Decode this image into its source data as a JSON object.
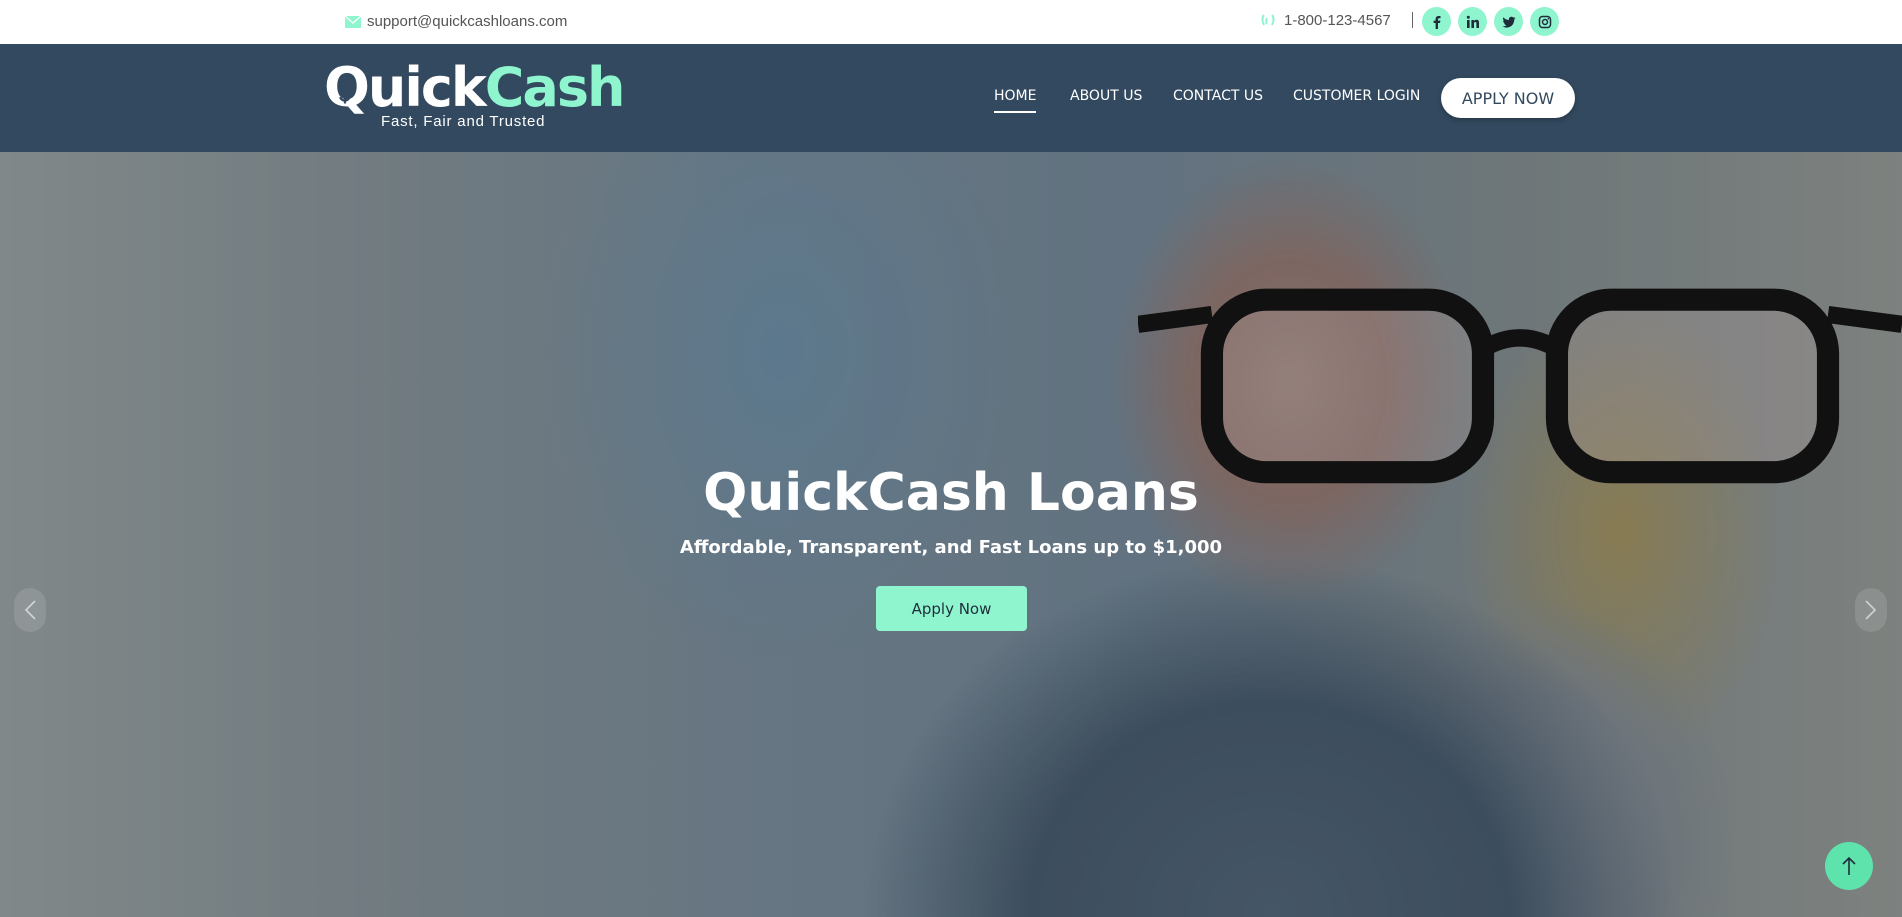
{
  "topbar": {
    "email": "support@quickcashloans.com",
    "phone": "1-800-123-4567",
    "socials": [
      {
        "icon": "facebook-icon",
        "label": "f"
      },
      {
        "icon": "linkedin-icon",
        "label": "in"
      },
      {
        "icon": "twitter-icon",
        "label": ""
      },
      {
        "icon": "instagram-icon",
        "label": ""
      }
    ]
  },
  "brand": {
    "name_part1": "Quick",
    "name_part2": "Cash",
    "tagline": "Fast, Fair and Trusted"
  },
  "nav": {
    "home": "HOME",
    "about": "ABOUT US",
    "contact": "CONTACT US",
    "login": "CUSTOMER LOGIN",
    "apply": "APPLY NOW",
    "active": "home"
  },
  "hero": {
    "title": "QuickCash Loans",
    "subtitle": "Affordable, Transparent, and Fast Loans up to $1,000",
    "button": "Apply Now"
  },
  "colors": {
    "header_bg": "#33495f",
    "accent": "#8ff5cf",
    "scroll_top": "#5fe3ad"
  }
}
